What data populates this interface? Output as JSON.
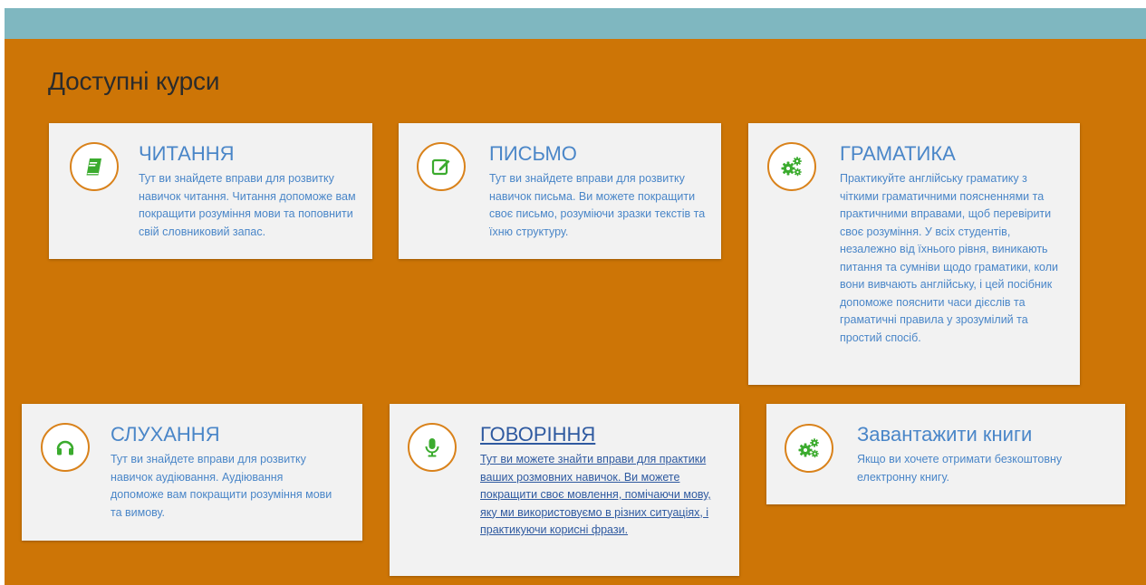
{
  "page": {
    "heading": "Доступні курси"
  },
  "colors": {
    "topbar": "#7fb7c0",
    "background": "#cd7506",
    "card": "#f2f2f2",
    "title": "#4a86c8",
    "icon_green": "#3bab2e",
    "icon_ring": "#d9821b"
  },
  "courses": [
    {
      "title": "ЧИТАННЯ",
      "icon": "book-icon",
      "text": "Тут ви знайдете вправи для розвитку навичок читання. Читання допоможе вам покращити розуміння мови та поповнити свій словниковий запас."
    },
    {
      "title": "ПИСЬМО",
      "icon": "edit-icon",
      "text": "Тут ви знайдете вправи для розвитку навичок письма. Ви можете покращити своє письмо, розуміючи зразки текстів та їхню структуру."
    },
    {
      "title": "ГРАМАТИКА",
      "icon": "gears-icon",
      "text": "Практикуйте англійську граматику з чіткими граматичними поясненнями та практичними вправами, щоб перевірити своє розуміння. У всіх студентів, незалежно від їхнього рівня, виникають питання та сумніви щодо граматики, коли вони вивчають англійську, і цей посібник допоможе пояснити часи дієслів та граматичні правила у зрозумілий та простий спосіб."
    },
    {
      "title": "СЛУХАННЯ",
      "icon": "headphones-icon",
      "text": "Тут ви знайдете вправи для розвитку навичок аудіювання. Аудіювання допоможе вам покращити розуміння мови та вимову."
    },
    {
      "title": "ГОВОРІННЯ",
      "icon": "microphone-icon",
      "text": "Тут ви можете знайти вправи для практики ваших розмовних навичок. Ви можете покращити своє мовлення, помічаючи мову, яку ми використовуємо в різних ситуаціях, і практикуючи корисні фрази."
    },
    {
      "title": "Завантажити книги",
      "icon": "gears-icon",
      "text": "Якщо ви хочете отримати безкоштовну електронну книгу."
    }
  ]
}
